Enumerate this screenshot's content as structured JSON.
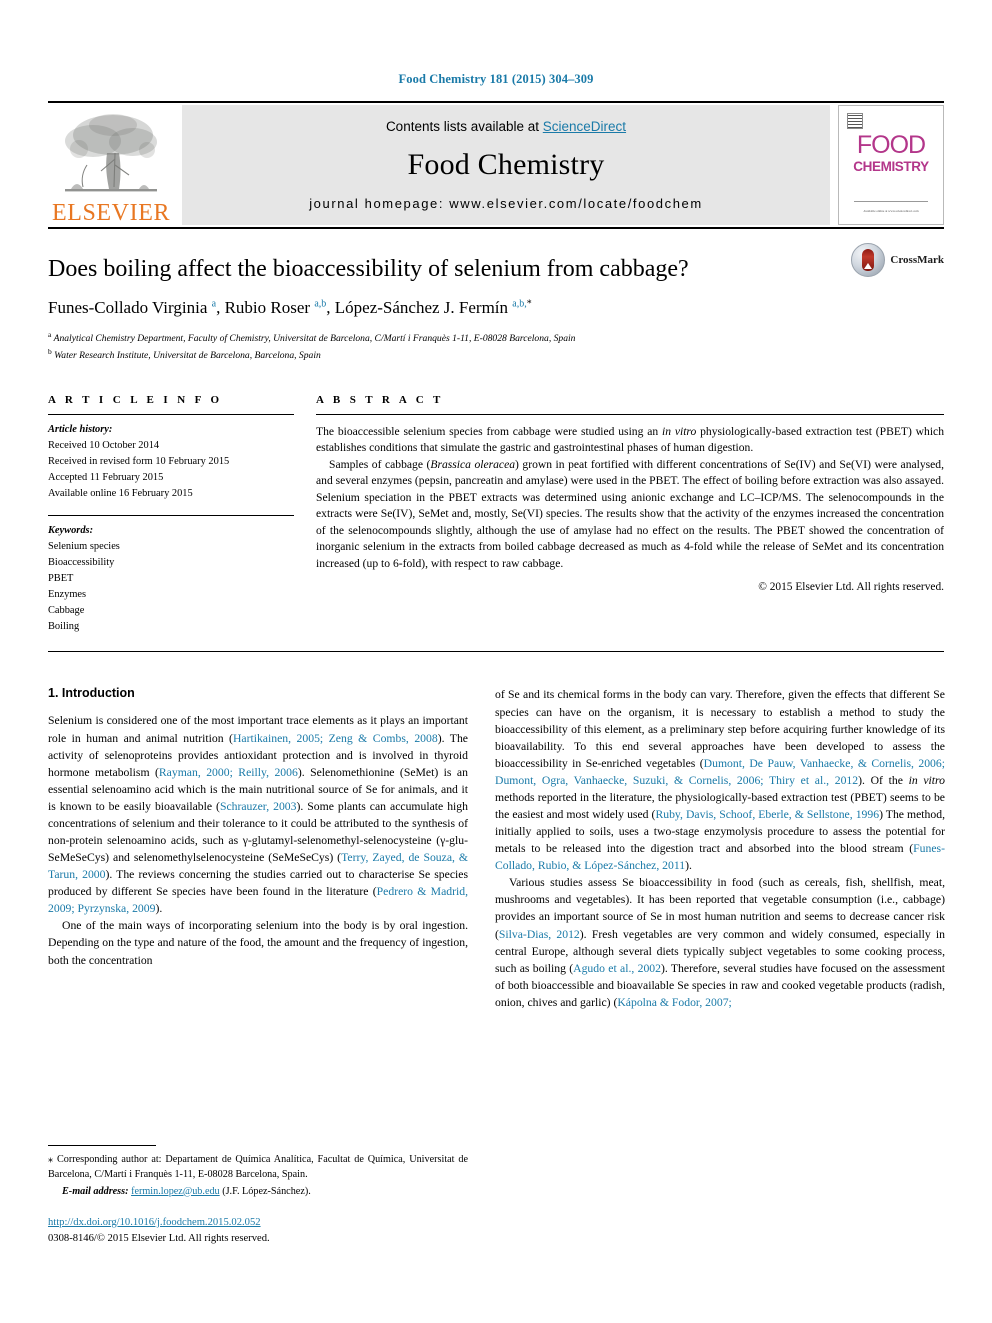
{
  "running_head": "Food Chemistry 181 (2015) 304–309",
  "masthead": {
    "contents_prefix": "Contents lists available at ",
    "sciencedirect": "ScienceDirect",
    "journal_title": "Food Chemistry",
    "homepage": "journal homepage: www.elsevier.com/locate/foodchem",
    "publisher_logo_text": "ELSEVIER",
    "cover_title_line1": "FOOD",
    "cover_title_line2": "CHEMISTRY",
    "cover_footer": "Available online at www.sciencedirect.com"
  },
  "article": {
    "title": "Does boiling affect the bioaccessibility of selenium from cabbage?",
    "authors_html": "Funes-Collado Virginia <sup>a</sup>, Rubio Roser <sup>a,b</sup>, López-Sánchez J. Fermín <sup>a,b,<span class=\"star\">*</span></sup>",
    "affiliation_a": "Analytical Chemistry Department, Faculty of Chemistry, Universitat de Barcelona, C/Martí i Franquès 1-11, E-08028 Barcelona, Spain",
    "affiliation_b": "Water Research Institute, Universitat de Barcelona, Barcelona, Spain",
    "crossmark_label": "CrossMark"
  },
  "article_info": {
    "heading": "A R T I C L E    I N F O",
    "history_label": "Article history:",
    "history": [
      "Received 10 October 2014",
      "Received in revised form 10 February 2015",
      "Accepted 11 February 2015",
      "Available online 16 February 2015"
    ],
    "keywords_label": "Keywords:",
    "keywords": [
      "Selenium species",
      "Bioaccessibility",
      "PBET",
      "Enzymes",
      "Cabbage",
      "Boiling"
    ]
  },
  "abstract": {
    "heading": "A B S T R A C T",
    "paragraph1_html": "The bioaccessible selenium species from cabbage were studied using an <span class=\"it\">in vitro</span> physiologically-based extraction test (PBET) which establishes conditions that simulate the gastric and gastrointestinal phases of human digestion.",
    "paragraph2_html": "Samples of cabbage (<span class=\"it\">Brassica oleracea</span>) grown in peat fortified with different concentrations of Se(IV) and Se(VI) were analysed, and several enzymes (pepsin, pancreatin and amylase) were used in the PBET. The effect of boiling before extraction was also assayed. Selenium speciation in the PBET extracts was determined using anionic exchange and LC–ICP/MS. The selenocompounds in the extracts were Se(IV), SeMet and, mostly, Se(VI) species. The results show that the activity of the enzymes increased the concentration of the selenocompounds slightly, although the use of amylase had no effect on the results. The PBET showed the concentration of inorganic selenium in the extracts from boiled cabbage decreased as much as 4-fold while the release of SeMet and its concentration increased (up to 6-fold), with respect to raw cabbage.",
    "copyright": "© 2015 Elsevier Ltd. All rights reserved."
  },
  "introduction": {
    "heading": "1. Introduction",
    "left_p1_html": "Selenium is considered one of the most important trace elements as it plays an important role in human and animal nutrition (<span class=\"ref\">Hartikainen, 2005; Zeng &amp; Combs, 2008</span>). The activity of selenoproteins provides antioxidant protection and is involved in thyroid hormone metabolism (<span class=\"ref\">Rayman, 2000; Reilly, 2006</span>). Selenomethionine (SeMet) is an essential selenoamino acid which is the main nutritional source of Se for animals, and it is known to be easily bioavailable (<span class=\"ref\">Schrauzer, 2003</span>). Some plants can accumulate high concentrations of selenium and their tolerance to it could be attributed to the synthesis of non-protein selenoamino acids, such as γ-glutamyl-selenomethyl-selenocysteine (γ-glu-SeMeSeCys) and selenomethylselenocysteine (SeMeSeCys) (<span class=\"ref\">Terry, Zayed, de Souza, &amp; Tarun, 2000</span>). The reviews concerning the studies carried out to characterise Se species produced by different Se species have been found in the literature (<span class=\"ref\">Pedrero &amp; Madrid, 2009; Pyrzynska, 2009</span>).",
    "left_p2_html": "One of the main ways of incorporating selenium into the body is by oral ingestion. Depending on the type and nature of the food, the amount and the frequency of ingestion, both the concentration",
    "right_p1_html": "of Se and its chemical forms in the body can vary. Therefore, given the effects that different Se species can have on the organism, it is necessary to establish a method to study the bioaccessibility of this element, as a preliminary step before acquiring further knowledge of its bioavailability. To this end several approaches have been developed to assess the bioaccessibility in Se-enriched vegetables (<span class=\"ref\">Dumont, De Pauw, Vanhaecke, &amp; Cornelis, 2006; Dumont, Ogra, Vanhaecke, Suzuki, &amp; Cornelis, 2006; Thiry et al., 2012</span>). Of the <span class=\"it\">in vitro</span> methods reported in the literature, the physiologically-based extraction test (PBET) seems to be the easiest and most widely used (<span class=\"ref\">Ruby, Davis, Schoof, Eberle, &amp; Sellstone, 1996</span>) The method, initially applied to soils, uses a two-stage enzymolysis procedure to assess the potential for metals to be released into the digestion tract and absorbed into the blood stream (<span class=\"ref\">Funes-Collado, Rubio, &amp; López-Sánchez, 2011</span>).",
    "right_p2_html": "Various studies assess Se bioaccessibility in food (such as cereals, fish, shellfish, meat, mushrooms and vegetables). It has been reported that vegetable consumption (i.e., cabbage) provides an important source of Se in most human nutrition and seems to decrease cancer risk (<span class=\"ref\">Silva-Dias, 2012</span>). Fresh vegetables are very common and widely consumed, especially in central Europe, although several diets typically subject vegetables to some cooking process, such as boiling (<span class=\"ref\">Agudo et al., 2002</span>). Therefore, several studies have focused on the assessment of both bioaccessible and bioavailable Se species in raw and cooked vegetable products (radish, onion, chives and garlic) (<span class=\"ref\">Kápolna &amp; Fodor, 2007;</span>"
  },
  "footnote": {
    "corresponding_html": "<span style=\"font-family:'Liberation Sans',sans-serif\">⁎</span> Corresponding author at: Departament de Química Analítica, Facultat de Química, Universitat de Barcelona, C/Martí i Franquès 1-11, E-08028 Barcelona, Spain.",
    "email_label": "E-mail address:",
    "email": "fermin.lopez@ub.edu",
    "email_owner": "(J.F. López-Sánchez).",
    "doi": "http://dx.doi.org/10.1016/j.foodchem.2015.02.052",
    "issn_line": "0308-8146/© 2015 Elsevier Ltd. All rights reserved."
  },
  "colors": {
    "link": "#1a7aa8",
    "elsevier_orange": "#e87722",
    "cover_magenta": "#b3368a"
  }
}
